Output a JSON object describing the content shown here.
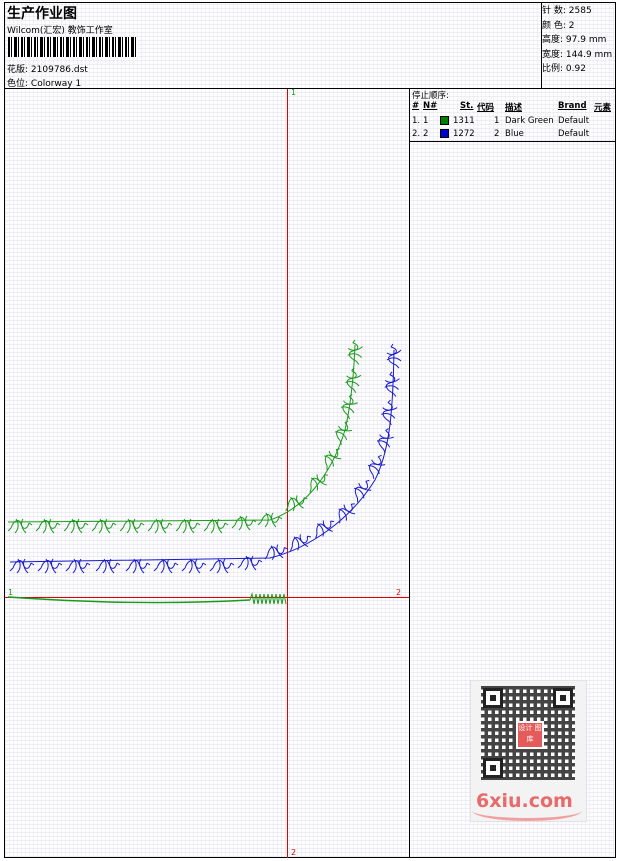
{
  "header": {
    "title": "生产作业图",
    "studio": "Wilcom(汇宏) 教饰工作室",
    "design_label": "花版:",
    "design_value": "2109786.dst",
    "colorway_label": "色位:",
    "colorway_value": "Colorway 1"
  },
  "stats": [
    {
      "label": "针 数:",
      "value": "2585"
    },
    {
      "label": "颜 色:",
      "value": "2"
    },
    {
      "label": "高度:",
      "value": "97.9 mm"
    },
    {
      "label": "宽度:",
      "value": "144.9 mm"
    },
    {
      "label": "比例:",
      "value": "0.92"
    }
  ],
  "legend": {
    "heading": "停止顺序:",
    "columns": [
      "#",
      "N#",
      "St.",
      "代码",
      "描述",
      "Brand",
      "元素"
    ],
    "rows": [
      {
        "index": "1.",
        "n": "1",
        "color": "#008000",
        "st": "1311",
        "code": "1",
        "desc": "Dark Green",
        "brand": "Default"
      },
      {
        "index": "2.",
        "n": "2",
        "color": "#0000cc",
        "st": "1272",
        "code": "2",
        "desc": "Blue",
        "brand": "Default"
      }
    ]
  },
  "axes": {
    "color": "#e00000",
    "top_label": "1",
    "left_label": "1",
    "right_label": "2",
    "bottom_label": "2"
  },
  "thread_colors": {
    "green": "#1a9a1a",
    "blue": "#1a1acc"
  },
  "watermark": {
    "text": "6xiu.com",
    "qr_logo": "设计 图库"
  }
}
